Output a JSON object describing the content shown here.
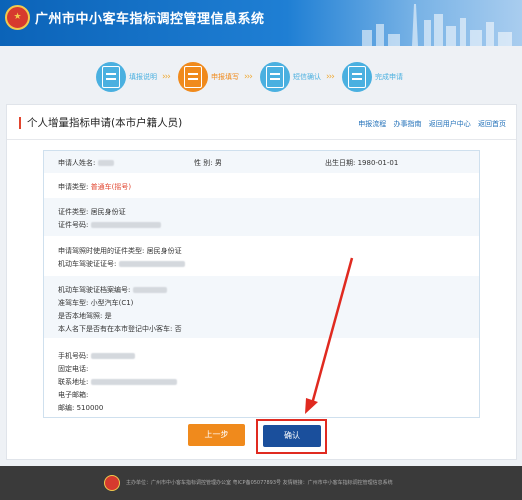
{
  "header": {
    "title": "广州市中小客车指标调控管理信息系统",
    "logo_glyph": "★"
  },
  "steps": [
    {
      "label": "填报说明",
      "color": "#4ab0e0",
      "state": "done"
    },
    {
      "label": "申报填写",
      "color": "#f08a1c",
      "state": "active"
    },
    {
      "label": "短信确认",
      "color": "#4ab0e0",
      "state": "todo"
    },
    {
      "label": "完成申请",
      "color": "#4ab0e0",
      "state": "todo"
    }
  ],
  "page": {
    "title": "个人增量指标申请(本市户籍人员)",
    "links": [
      "申报流程",
      "办事指南",
      "返回用户中心",
      "返回首页"
    ]
  },
  "form": {
    "name_label": "申请人姓名:",
    "gender_label": "性 别:",
    "gender_value": "男",
    "birth_label": "出生日期:",
    "birth_value": "1980-01-01",
    "apply_type_label": "申请类型:",
    "apply_type_value": "普通车(摇号)",
    "id_type_label": "证件类型:",
    "id_type_value": "居民身份证",
    "id_no_label": "证件号码:",
    "license_id_type_label": "申请驾照时使用的证件类型:",
    "license_id_type_value": "居民身份证",
    "license_id_no_label": "机动车驾驶证证号:",
    "archive_no_label": "机动车驾驶证档案编号:",
    "vehicle_class_label": "准驾车型:",
    "vehicle_class_value": "小型汽车(C1)",
    "local_license_label": "是否本地驾照:",
    "local_license_value": "是",
    "registered_car_label": "本人名下是否有在本市登记中小客车:",
    "registered_car_value": "否",
    "phone_label": "手机号码:",
    "landline_label": "固定电话:",
    "address_label": "联系地址:",
    "email_label": "电子邮箱:",
    "postcode_label": "邮编:",
    "postcode_value": "510000"
  },
  "buttons": {
    "prev": "上一步",
    "confirm": "确认"
  },
  "footer": {
    "text": "主办单位：广州市中小客车指标调控管理办公室   粤ICP备05077893号   友情链接：广州市中小客车指标调控管理信息系统"
  },
  "colors": {
    "header_blue": "#0b63b8",
    "accent_orange": "#f08a1c",
    "confirm_blue": "#1a4f9c",
    "annotation_red": "#e02a20"
  }
}
